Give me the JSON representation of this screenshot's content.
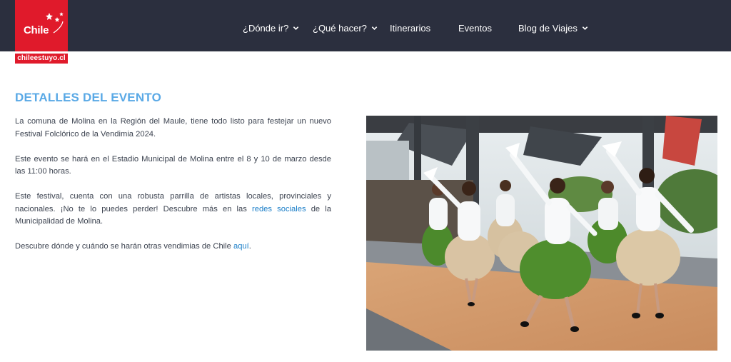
{
  "header": {
    "logo_text": "Chile",
    "site_tag": "chileestuyo.cl",
    "nav": [
      {
        "label": "¿Dónde ir?",
        "has_dropdown": true
      },
      {
        "label": "¿Qué hacer?",
        "has_dropdown": true
      },
      {
        "label": "Itinerarios",
        "has_dropdown": false
      },
      {
        "label": "Eventos",
        "has_dropdown": false
      },
      {
        "label": "Blog de Viajes",
        "has_dropdown": true
      }
    ],
    "colors": {
      "bar": "#2b2f3e",
      "logo": "#e01a2b"
    }
  },
  "main": {
    "title": "DETALLES DEL EVENTO",
    "p1": "La comuna de Molina en la Región del Maule, tiene todo listo para festejar un nuevo Festival Folclórico de la Vendimia 2024.",
    "p2": "Este evento se hará en el Estadio Municipal de Molina entre el 8 y 10 de marzo desde las 11:00 horas.",
    "p3_before": "Este festival, cuenta con una robusta parrilla de artistas locales, provinciales y nacionales. ¡No te lo puedes perder! Descubre más en las ",
    "p3_link": "redes sociales",
    "p3_after": " de la Municipalidad de Molina.",
    "p4_before": "Descubre dónde y cuándo se harán otras vendimias de Chile ",
    "p4_link": "aquí",
    "p4_after": ".",
    "colors": {
      "title": "#5aa9e6",
      "link": "#1a7ec8"
    }
  },
  "photo": {
    "subject": "folk dancers in white blouses and green and beige skirts waving white handkerchiefs on a wooden stage"
  }
}
